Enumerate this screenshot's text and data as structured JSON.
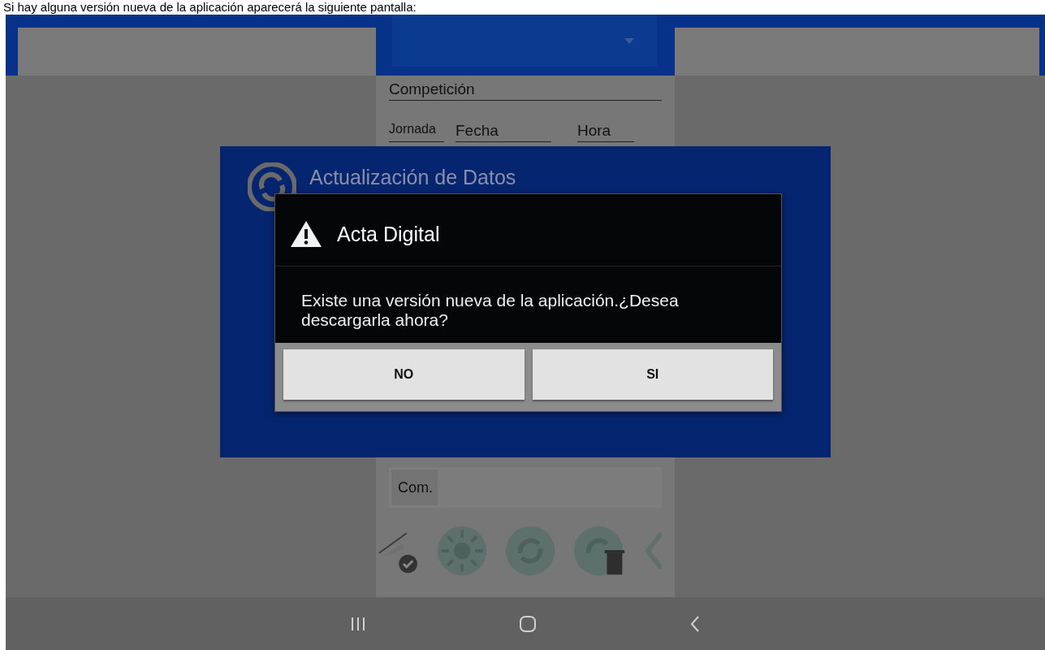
{
  "caption": "Si hay alguna versión nueva de la aplicación aparecerá la siguiente pantalla:",
  "form": {
    "competition_label": "Competición",
    "round_label": "Jornada",
    "date_label": "Fecha",
    "time_label": "Hora",
    "comments_label": "Com."
  },
  "background_panel": {
    "title": "Actualización de Datos"
  },
  "dialog": {
    "title": "Acta Digital",
    "message": "Existe una versión nueva de la aplicación.¿Desea descargarla ahora?",
    "buttons": [
      "NO",
      "SI"
    ]
  }
}
